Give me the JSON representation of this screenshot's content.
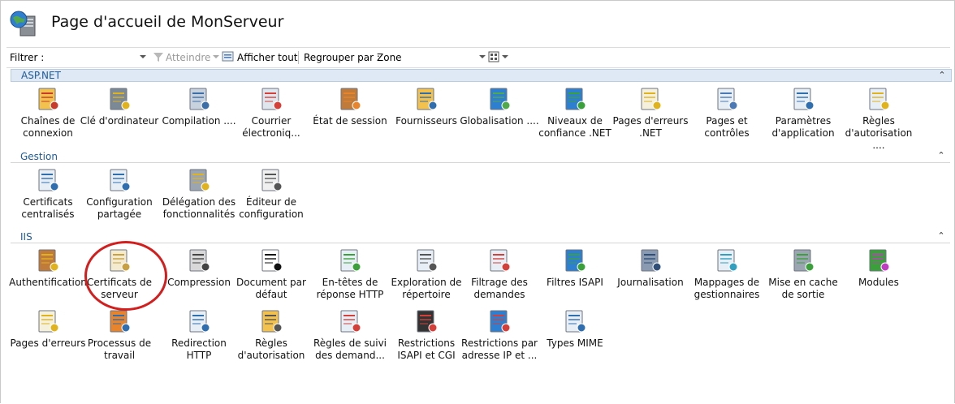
{
  "header": {
    "title": "Page d'accueil de MonServeur"
  },
  "toolbar": {
    "filter_label": "Filtrer :",
    "filter_value": "",
    "go_label": "Atteindre",
    "show_all_label": "Afficher tout",
    "group_by_label": "Regrouper par :",
    "group_by_value": "Zone"
  },
  "sections": [
    {
      "label": "ASP.NET",
      "items": [
        {
          "label": "Chaînes de connexion",
          "icon": "connection-strings-icon"
        },
        {
          "label": "Clé d'ordinateur",
          "icon": "machine-key-icon"
        },
        {
          "label": "Compilation ....",
          "icon": "compilation-icon"
        },
        {
          "label": "Courrier électroniq...",
          "icon": "smtp-email-icon"
        },
        {
          "label": "État de session",
          "icon": "session-state-icon"
        },
        {
          "label": "Fournisseurs",
          "icon": "providers-icon"
        },
        {
          "label": "Globalisation ....",
          "icon": "globalization-icon"
        },
        {
          "label": "Niveaux de confiance .NET",
          "icon": "trust-levels-icon"
        },
        {
          "label": "Pages d'erreurs .NET",
          "icon": "net-error-pages-icon"
        },
        {
          "label": "Pages et contrôles",
          "icon": "pages-controls-icon"
        },
        {
          "label": "Paramètres d'application",
          "icon": "app-settings-icon"
        },
        {
          "label": "Règles d'autorisation ....",
          "icon": "net-authorization-icon"
        }
      ]
    },
    {
      "label": "Gestion",
      "items": [
        {
          "label": "Certificats centralisés",
          "icon": "central-certs-icon"
        },
        {
          "label": "Configuration partagée",
          "icon": "shared-config-icon"
        },
        {
          "label": "Délégation des fonctionnalités",
          "icon": "feature-delegation-icon"
        },
        {
          "label": "Éditeur de configuration",
          "icon": "config-editor-icon"
        }
      ]
    },
    {
      "label": "IIS",
      "items": [
        {
          "label": "Authentification",
          "icon": "authentication-icon"
        },
        {
          "label": "Certificats de serveur",
          "icon": "server-certificates-icon"
        },
        {
          "label": "Compression",
          "icon": "compression-icon"
        },
        {
          "label": "Document par défaut",
          "icon": "default-document-icon"
        },
        {
          "label": "En-têtes de réponse HTTP",
          "icon": "http-headers-icon"
        },
        {
          "label": "Exploration de répertoire",
          "icon": "directory-browsing-icon"
        },
        {
          "label": "Filtrage des demandes",
          "icon": "request-filtering-icon"
        },
        {
          "label": "Filtres ISAPI",
          "icon": "isapi-filters-icon"
        },
        {
          "label": "Journalisation",
          "icon": "logging-icon"
        },
        {
          "label": "Mappages de gestionnaires",
          "icon": "handler-mappings-icon"
        },
        {
          "label": "Mise en cache de sortie",
          "icon": "output-caching-icon"
        },
        {
          "label": "Modules",
          "icon": "modules-icon"
        },
        {
          "label": "Pages d'erreurs",
          "icon": "error-pages-icon"
        },
        {
          "label": "Processus de travail",
          "icon": "worker-processes-icon"
        },
        {
          "label": "Redirection HTTP",
          "icon": "http-redirect-icon"
        },
        {
          "label": "Règles d'autorisation",
          "icon": "authorization-rules-icon"
        },
        {
          "label": "Règles de suivi des demand...",
          "icon": "failed-request-tracing-icon"
        },
        {
          "label": "Restrictions ISAPI et CGI",
          "icon": "isapi-cgi-restrictions-icon"
        },
        {
          "label": "Restrictions par adresse IP et ...",
          "icon": "ip-restrictions-icon"
        },
        {
          "label": "Types MIME",
          "icon": "mime-types-icon"
        }
      ]
    }
  ]
}
